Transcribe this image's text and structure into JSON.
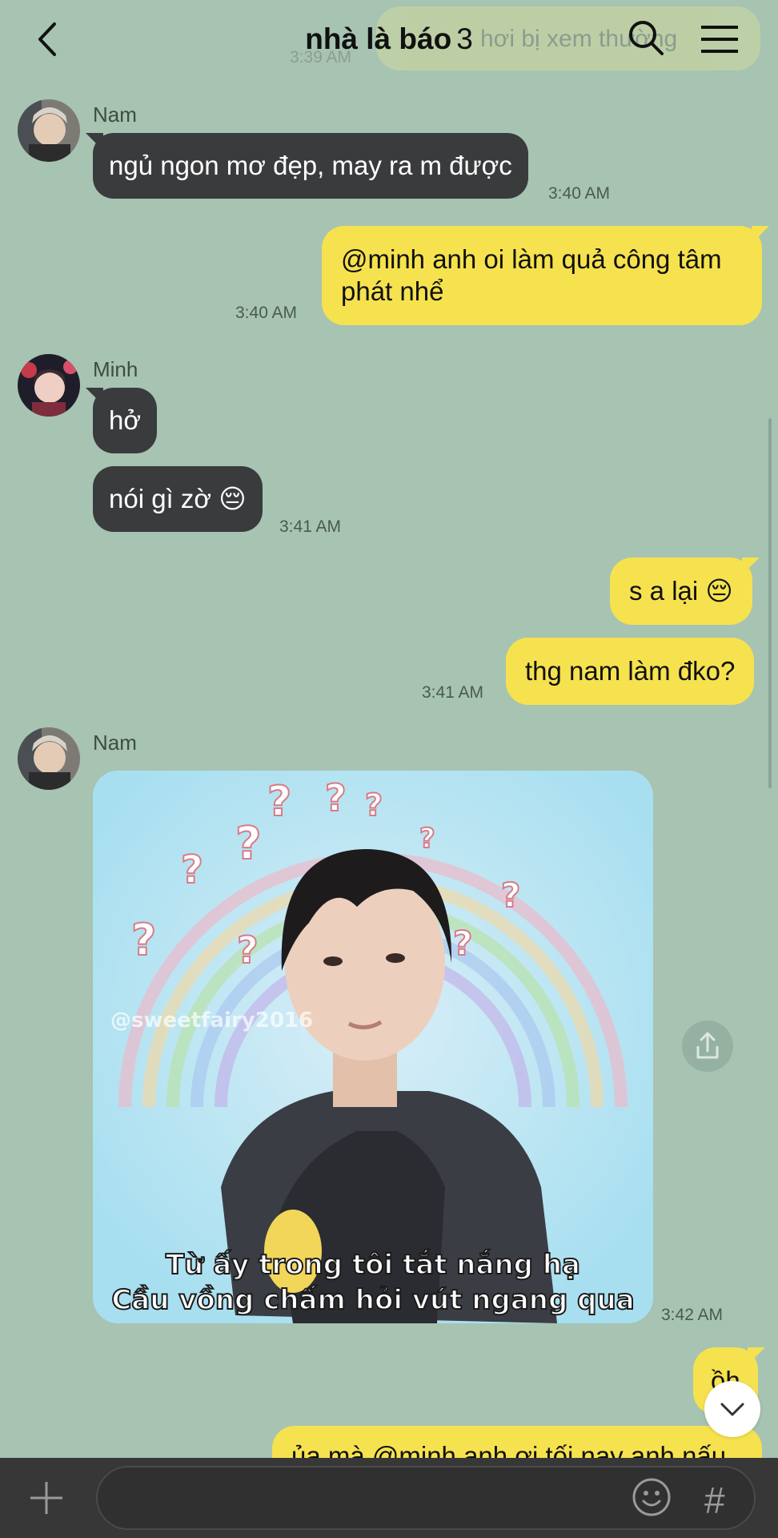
{
  "header": {
    "title": "nhà là báo",
    "member_count": "3",
    "ghost_text": "hơi bị xem thường",
    "ghost_time": "3:39 AM"
  },
  "messages": [
    {
      "sender": "Nam",
      "text": "ngủ ngon mơ đẹp, may ra m được",
      "time": "3:40 AM"
    },
    {
      "line1": "@minh anh oi làm quả công tâm",
      "line2": "phát nhể",
      "time": "3:40 AM"
    },
    {
      "sender": "Minh",
      "text": "hở"
    },
    {
      "text": "nói gì zờ 😔",
      "time": "3:41 AM"
    },
    {
      "text": "s a lại 😔"
    },
    {
      "text": "thg nam làm đko?",
      "time": "3:41 AM"
    },
    {
      "sender": "Nam",
      "image_watermark": "@sweetfairy2016",
      "image_caption_1": "Từ ấy trong tôi tắt nắng hạ",
      "image_caption_2": "Cầu vồng chấm hỏi vút ngang qua",
      "time": "3:42 AM"
    },
    {
      "text": "ồh"
    },
    {
      "text": "ủa mà @minh anh ơi tối nay anh nấu"
    }
  ],
  "icons": {
    "back": "chevron-left-icon",
    "search": "search-icon",
    "menu": "hamburger-icon",
    "share": "share-icon",
    "scroll_down": "chevron-down-icon",
    "add": "plus-icon",
    "emoji": "emoji-icon",
    "hash": "#"
  }
}
